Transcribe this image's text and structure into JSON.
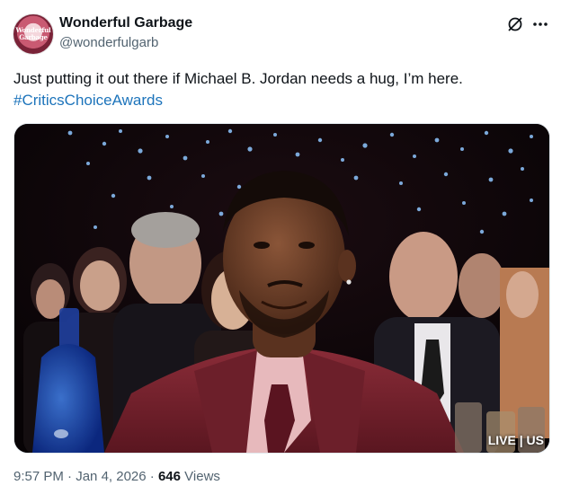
{
  "author": {
    "name": "Wonderful Garbage",
    "handle": "@wonderfulgarb",
    "avatar_text": "Wonderful Garbage"
  },
  "header_icons": [
    "grok-icon",
    "more-icon"
  ],
  "tweet": {
    "text": "Just putting it out there if Michael B. Jordan needs a hug, I’m here.",
    "hashtag": "#CriticsChoiceAwards"
  },
  "media": {
    "overlay_text": "LIVE | US"
  },
  "meta": {
    "time": "9:57 PM",
    "sep1": "·",
    "date": "Jan 4, 2026",
    "sep2": "·",
    "views_count": "646",
    "views_label": "Views"
  },
  "colors": {
    "text": "#0f1419",
    "secondary": "#536471",
    "hashtag": "#1d74bb",
    "suit": "#7a2431"
  }
}
